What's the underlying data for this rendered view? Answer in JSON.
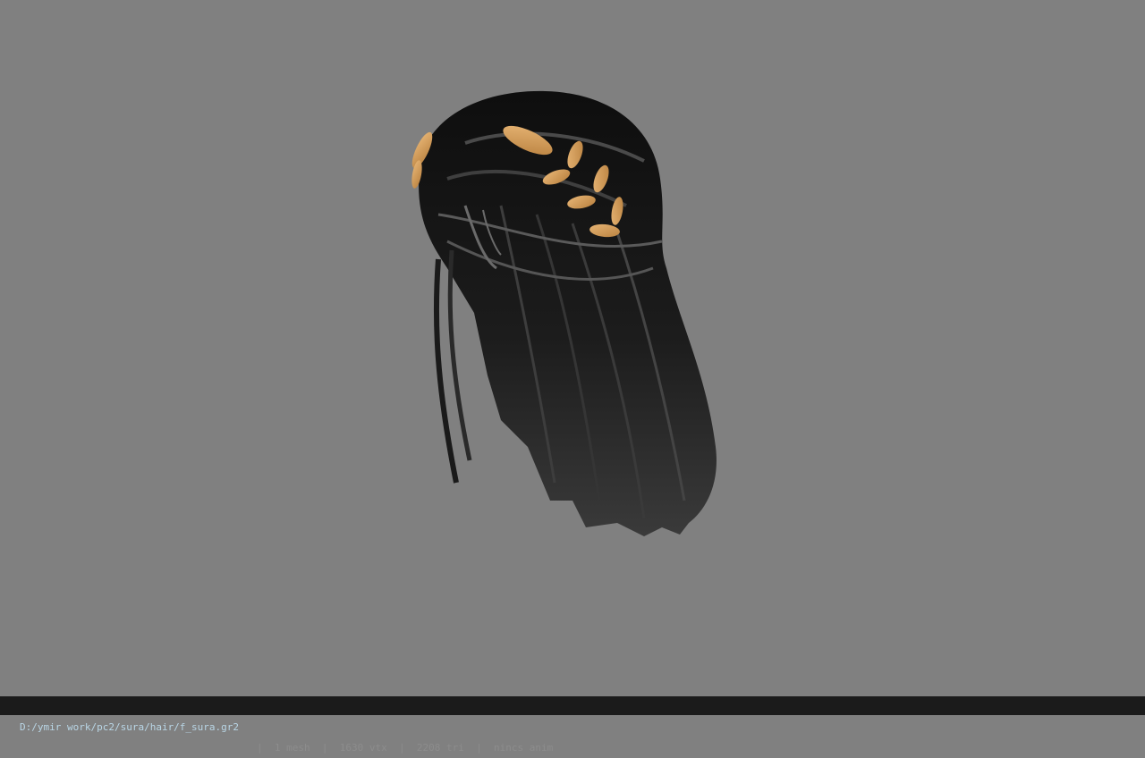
{
  "viewer": {
    "background_color": "#808080",
    "model": {
      "description_icon": "hair-mesh-with-laurel-ornament",
      "hair_color": "#1a1a1a",
      "ornament_color": "#d9a25e"
    }
  },
  "statusbar": {
    "file_path": "D:/ymir work/pc2/sura/hair/f_sura.gr2",
    "separator": "|",
    "mesh_count": "1 mesh",
    "vertex_count": "1630 vtx",
    "triangle_count": "2208 tri",
    "anim_status": "nincs anim"
  }
}
